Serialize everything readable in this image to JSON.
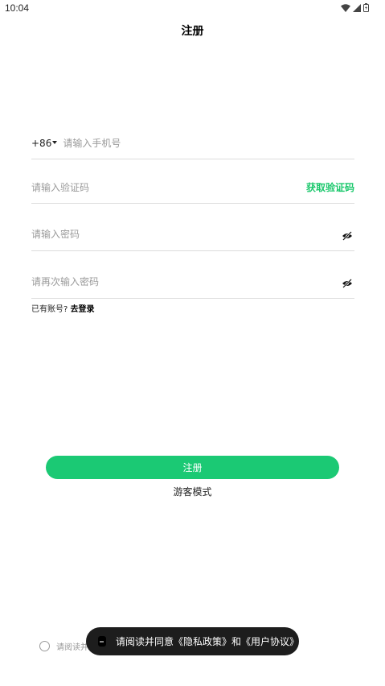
{
  "status_bar": {
    "time": "10:04",
    "icons": [
      "wifi-icon",
      "cellular-signal-icon",
      "battery-icon"
    ]
  },
  "header": {
    "title": "注册"
  },
  "form": {
    "phone": {
      "country_code": "+86",
      "placeholder": "请输入手机号"
    },
    "verification": {
      "placeholder": "请输入验证码",
      "get_code_label": "获取验证码"
    },
    "password": {
      "placeholder": "请输入密码",
      "toggle_icon": "eye-off-icon"
    },
    "confirm_password": {
      "placeholder": "请再次输入密码",
      "toggle_icon": "eye-off-icon"
    }
  },
  "login_hint": {
    "text": "已有账号?",
    "link": "去登录"
  },
  "register_button": {
    "label": "注册"
  },
  "guest_mode": {
    "label": "游客模式"
  },
  "agreement": {
    "checked": false,
    "text": "请阅读并"
  },
  "toast": {
    "text": "请阅读并同意《隐私政策》和《用户协议》"
  },
  "colors": {
    "accent": "#1bc974",
    "link_green": "#1cc86d",
    "toast_bg": "#1d1d1d",
    "divider": "#dcdcdc"
  }
}
